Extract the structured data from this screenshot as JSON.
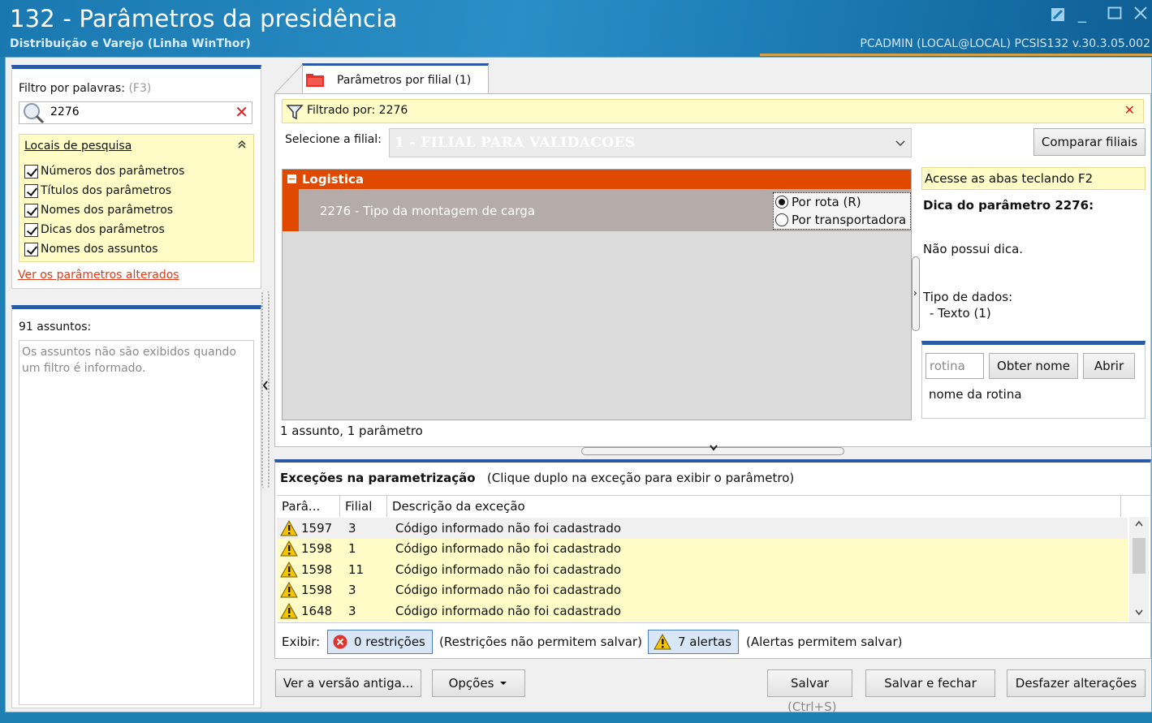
{
  "window": {
    "title": "132 - Parâmetros da presidência",
    "subtitle": "Distribuição e Varejo (Linha WinThor)",
    "user_info": "PCADMIN (LOCAL@LOCAL)   PCSIS132  v.30.3.05.002"
  },
  "filter": {
    "label": "Filtro por palavras:",
    "shortcut": "(F3)",
    "search_value": "2276",
    "locais_title": "Locais de pesquisa",
    "options": [
      "Números dos parâmetros",
      "Títulos dos parâmetros",
      "Nomes dos parâmetros",
      "Dicas dos parâmetros",
      "Nomes dos assuntos"
    ],
    "changed_link": "Ver os parâmetros alterados"
  },
  "assuntos": {
    "title": "91 assuntos:",
    "message": "Os assuntos não são exibidos quando um filtro é informado."
  },
  "tab": {
    "label": "Parâmetros por filial  (1)"
  },
  "main": {
    "filtered_by": "Filtrado por: 2276",
    "filial_label": "Selecione a filial:",
    "filial_value": "1 - FILIAL PARA VALIDACOES",
    "compare_button": "Comparar filiais",
    "group_title": "Logistica",
    "param_label": "2276 - Tipo da montagem de carga",
    "radio_options": [
      "Por rota (R)",
      "Por transportadora"
    ],
    "selected_radio": 0,
    "count_text": "1 assunto, 1 parâmetro"
  },
  "hint": {
    "bar_text": "Acesse as abas teclando F2",
    "title": "Dica do parâmetro 2276:",
    "text": "Não possui dica.",
    "type_title": "Tipo de dados:",
    "type_value": "- Texto (1)",
    "rotina_placeholder": "rotina",
    "obter_button": "Obter nome",
    "abrir_button": "Abrir",
    "rotina_name": "nome da rotina"
  },
  "exceptions": {
    "title": "Exceções na parametrização",
    "subtitle": "(Clique duplo na exceção para exibir o parâmetro)",
    "columns": [
      "Parâ...",
      "Filial",
      "Descrição da exceção"
    ],
    "rows": [
      {
        "param": "1597",
        "filial": "3",
        "desc": "Código informado não foi cadastrado"
      },
      {
        "param": "1598",
        "filial": "1",
        "desc": "Código informado não foi cadastrado"
      },
      {
        "param": "1598",
        "filial": "11",
        "desc": "Código informado não foi cadastrado"
      },
      {
        "param": "1598",
        "filial": "3",
        "desc": "Código informado não foi cadastrado"
      },
      {
        "param": "1648",
        "filial": "3",
        "desc": "Código informado não foi cadastrado"
      }
    ],
    "exibir_label": "Exibir:",
    "restricoes_button": "0 restrições",
    "restricoes_note": "(Restrições não permitem salvar)",
    "alertas_button": "7 alertas",
    "alertas_note": "(Alertas permitem salvar)"
  },
  "footer": {
    "old_version_button": "Ver a versão antiga...",
    "options_button": "Opções",
    "save_button": "Salvar",
    "save_hint": "(Ctrl+S)",
    "save_close_button": "Salvar e fechar",
    "undo_button": "Desfazer alterações"
  },
  "colors": {
    "accent_blue": "#2a5aa6",
    "group_orange": "#e04a00",
    "hint_yellow": "#fffcc8",
    "title_blue": "#1e7fb4"
  }
}
